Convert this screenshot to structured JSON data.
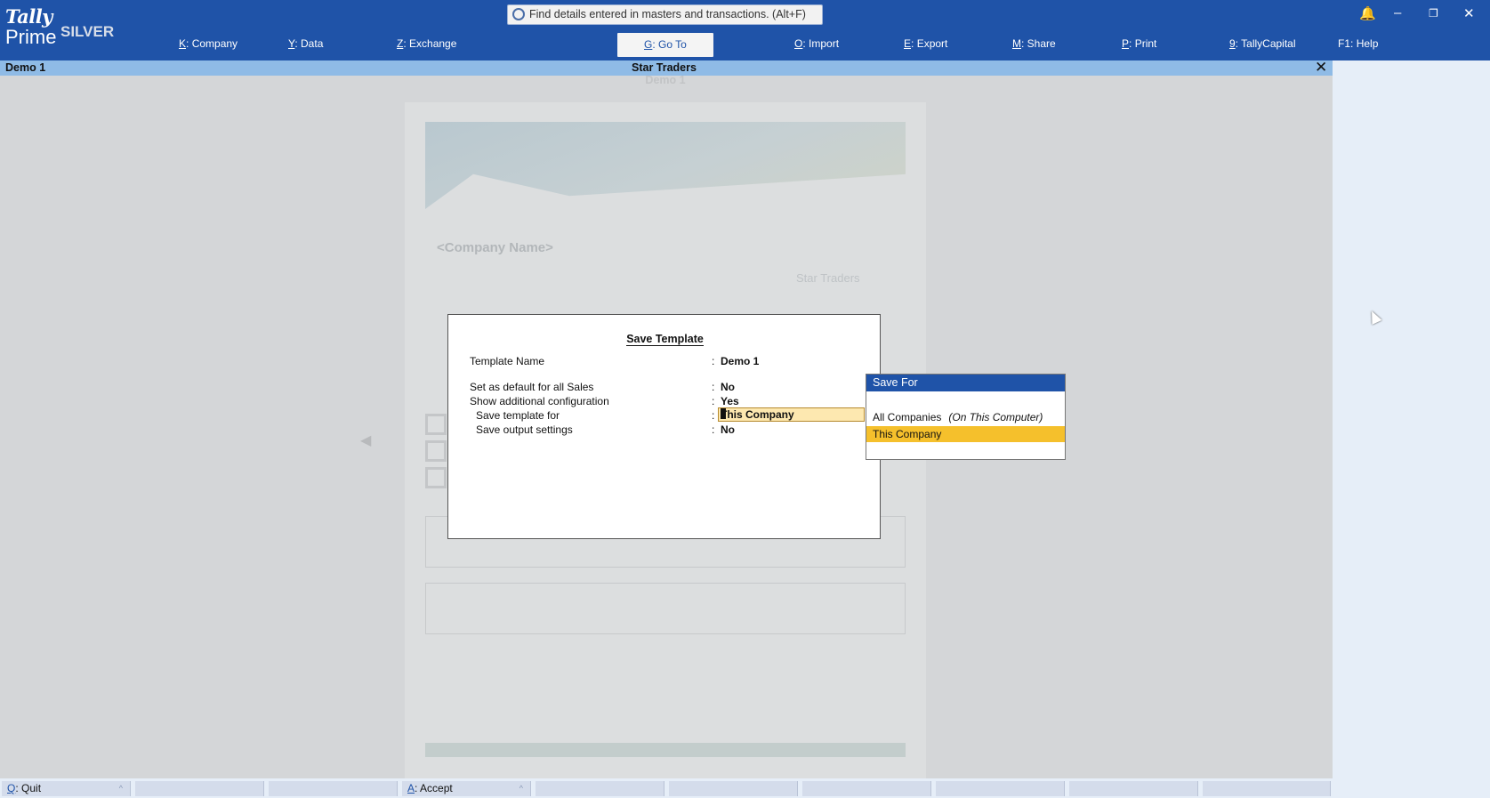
{
  "app": {
    "logo_top": "Tally",
    "logo_bottom": "Prime",
    "edition": "SILVER",
    "search_placeholder": "Find details entered in masters and transactions. (Alt+F)"
  },
  "menu": [
    {
      "key": "K",
      "label": "Company"
    },
    {
      "key": "Y",
      "label": "Data"
    },
    {
      "key": "Z",
      "label": "Exchange"
    },
    {
      "key": "G",
      "label": "Go To"
    },
    {
      "key": "O",
      "label": "Import"
    },
    {
      "key": "E",
      "label": "Export"
    },
    {
      "key": "M",
      "label": "Share"
    },
    {
      "key": "P",
      "label": "Print"
    },
    {
      "key": "9",
      "label": "TallyCapital"
    },
    {
      "key": "F1",
      "label": "Help"
    }
  ],
  "title_bar": {
    "left": "Demo 1",
    "center": "Star Traders"
  },
  "preview": {
    "subtitle": "Demo 1",
    "company_placeholder": "<Company Name>",
    "brand": "Star Traders"
  },
  "dialog": {
    "title": "Save Template",
    "fields": [
      {
        "label": "Template Name",
        "value": "Demo 1"
      },
      {
        "label": "Set as default for all Sales",
        "value": "No"
      },
      {
        "label": "Show additional configuration",
        "value": "Yes"
      },
      {
        "label": "Save template for",
        "value": "This Company"
      },
      {
        "label": "Save output settings",
        "value": "No"
      }
    ]
  },
  "popup": {
    "title": "Save For",
    "options": [
      {
        "label": "All Companies",
        "note": "(On This Computer)"
      },
      {
        "label": "This Company",
        "selected": true
      }
    ]
  },
  "bottom_bar": [
    {
      "key": "Q",
      "label": "Quit"
    },
    {
      "key": "A",
      "label": "Accept"
    }
  ],
  "colors": {
    "brand_blue": "#1f53a8",
    "title_strip": "#8fbbe6",
    "selection": "#f5c02c",
    "edit_field": "#fde8b0"
  }
}
